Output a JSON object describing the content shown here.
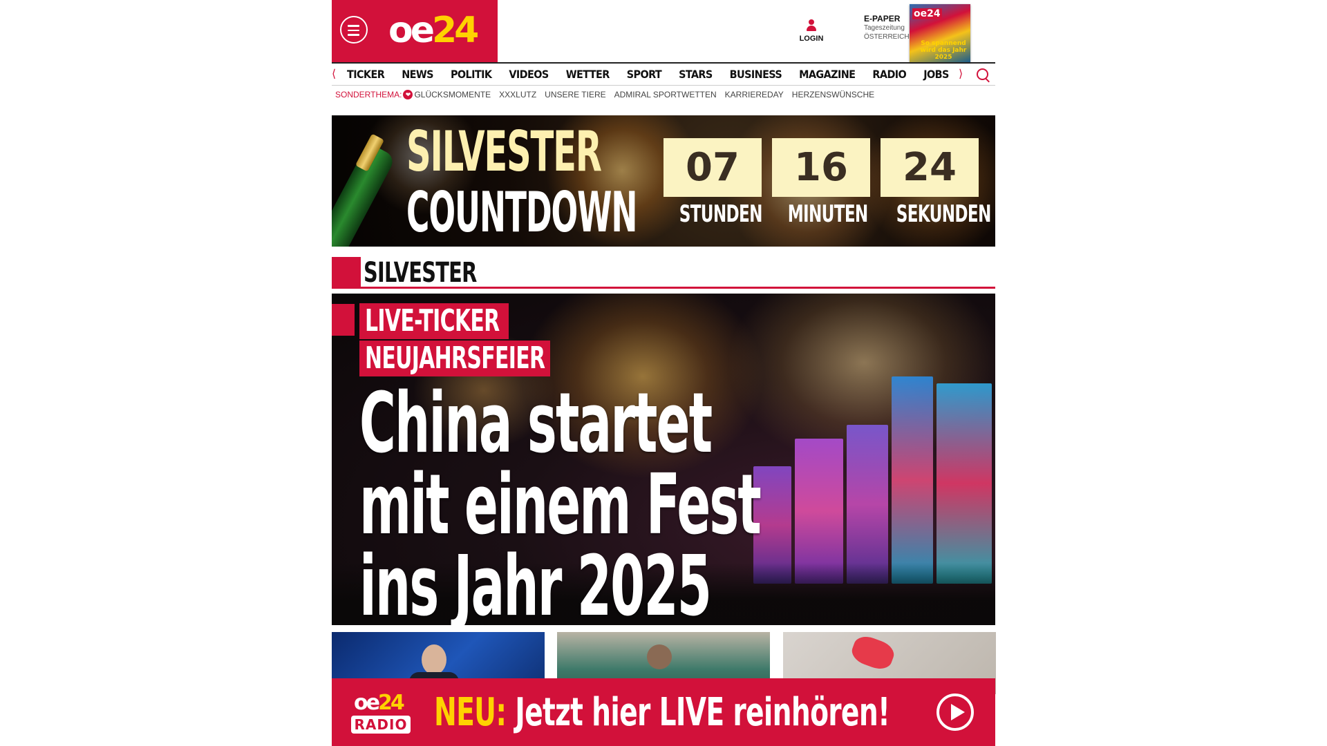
{
  "header": {
    "logo_main": "oe",
    "logo_num": "24",
    "login_label": "LOGIN",
    "epaper": {
      "title": "E-PAPER",
      "line1": "Tageszeitung",
      "line2": "ÖSTERREICH"
    },
    "epaper_cover": {
      "logo": "oe24",
      "headline": "So spannend wird das Jahr 2025"
    }
  },
  "nav": {
    "items": [
      "TICKER",
      "NEWS",
      "POLITIK",
      "VIDEOS",
      "WETTER",
      "SPORT",
      "STARS",
      "BUSINESS",
      "MAGAZINE",
      "RADIO",
      "JOBS"
    ]
  },
  "subnav": {
    "label": "SONDERTHEMA:",
    "items": [
      "GLÜCKSMOMENTE",
      "XXXLUTZ",
      "UNSERE TIERE",
      "ADMIRAL SPORTWETTEN",
      "KARRIEREDAY",
      "HERZENSWÜNSCHE"
    ]
  },
  "countdown": {
    "title1": "SILVESTER",
    "title2": "COUNTDOWN",
    "hours": "07",
    "minutes": "16",
    "seconds": "24",
    "hours_label": "STUNDEN",
    "minutes_label": "MINUTEN",
    "seconds_label": "SEKUNDEN"
  },
  "section": {
    "title": "SILVESTER"
  },
  "hero": {
    "tag1": "LIVE-TICKER",
    "tag2": "NEUJAHRSFEIER",
    "title_lines": [
      "China startet",
      "mit einem Fest",
      "ins Jahr 2025"
    ]
  },
  "radio": {
    "logo_main": "oe",
    "logo_num": "24",
    "logo_label": "RADIO",
    "neu": "NEU:",
    "text": "Jetzt hier LIVE reinhören!"
  },
  "colors": {
    "brand_red": "#d2113a",
    "brand_yellow": "#ffd200",
    "countdown_box": "#fbf3c2"
  },
  "icons": [
    "menu-icon",
    "user-icon",
    "search-icon",
    "heart-icon",
    "chevron-left-icon",
    "chevron-right-icon",
    "play-icon"
  ]
}
